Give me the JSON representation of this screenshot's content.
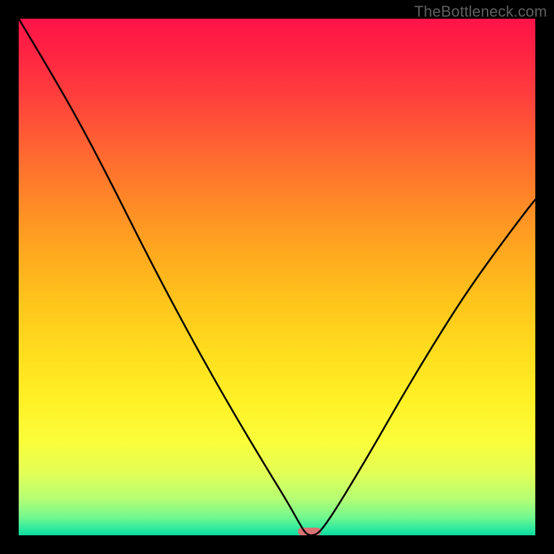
{
  "watermark": "TheBottleneck.com",
  "marker": {
    "x_frac": 0.563,
    "width_frac": 0.045,
    "color": "#d97272"
  },
  "chart_data": {
    "type": "line",
    "title": "",
    "xlabel": "",
    "ylabel": "",
    "xlim": [
      0,
      1
    ],
    "ylim": [
      0,
      100
    ],
    "background_gradient": [
      {
        "stop": 0.0,
        "color": "#ff1449"
      },
      {
        "stop": 0.06,
        "color": "#ff2243"
      },
      {
        "stop": 0.15,
        "color": "#ff3f3c"
      },
      {
        "stop": 0.25,
        "color": "#ff6432"
      },
      {
        "stop": 0.35,
        "color": "#ff8727"
      },
      {
        "stop": 0.45,
        "color": "#ffa81f"
      },
      {
        "stop": 0.55,
        "color": "#ffc51b"
      },
      {
        "stop": 0.65,
        "color": "#ffde1e"
      },
      {
        "stop": 0.74,
        "color": "#fff126"
      },
      {
        "stop": 0.82,
        "color": "#fafd3a"
      },
      {
        "stop": 0.88,
        "color": "#e2ff56"
      },
      {
        "stop": 0.93,
        "color": "#b4fe74"
      },
      {
        "stop": 0.965,
        "color": "#72f88d"
      },
      {
        "stop": 0.985,
        "color": "#35eb9d"
      },
      {
        "stop": 1.0,
        "color": "#09db9f"
      }
    ],
    "series": [
      {
        "name": "bottleneck-curve",
        "color": "#000000",
        "x": [
          0.0,
          0.06,
          0.12,
          0.18,
          0.24,
          0.3,
          0.36,
          0.42,
          0.48,
          0.52,
          0.545,
          0.558,
          0.575,
          0.59,
          0.62,
          0.68,
          0.74,
          0.8,
          0.86,
          0.92,
          0.98,
          1.0
        ],
        "y": [
          100.0,
          90.0,
          79.5,
          68.0,
          56.0,
          44.5,
          33.5,
          23.0,
          13.0,
          6.5,
          2.0,
          0.0,
          0.0,
          1.5,
          6.0,
          16.0,
          26.5,
          36.5,
          46.0,
          54.5,
          62.5,
          65.0
        ]
      }
    ],
    "marker_region": {
      "x_start": 0.545,
      "x_end": 0.585
    }
  }
}
